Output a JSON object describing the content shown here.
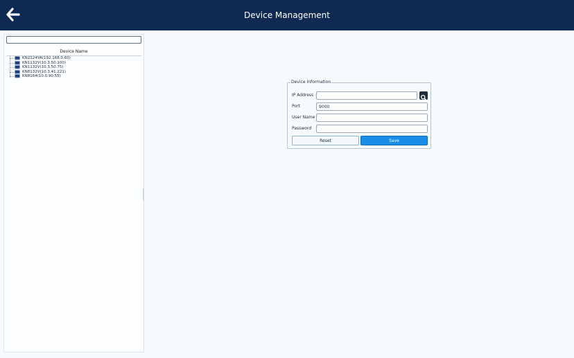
{
  "header": {
    "title": "Device Management",
    "back_icon": "arrow-left-icon",
    "background_color": "#0e2a52"
  },
  "sidebar": {
    "search": {
      "value": "",
      "placeholder": ""
    },
    "column_header": "Device Name",
    "devices": [
      {
        "label": "KN2124VA(192.168.0.60)"
      },
      {
        "label": "KN1132V(10.3.50.100)"
      },
      {
        "label": "KN1132V(10.3.50.75)"
      },
      {
        "label": "KN8132V(10.3.41.221)"
      },
      {
        "label": "KN8164(10.0.90.55)"
      }
    ]
  },
  "device_info": {
    "legend": "Device Information",
    "ip_label": "IP Address",
    "ip_value": "",
    "port_label": "Port",
    "port_value": "9000",
    "username_label": "User Name",
    "username_value": "",
    "password_label": "Password",
    "password_value": "",
    "search_icon": "search-icon",
    "reset_label": "Reset",
    "save_label": "Save",
    "save_color": "#1a8de6"
  }
}
